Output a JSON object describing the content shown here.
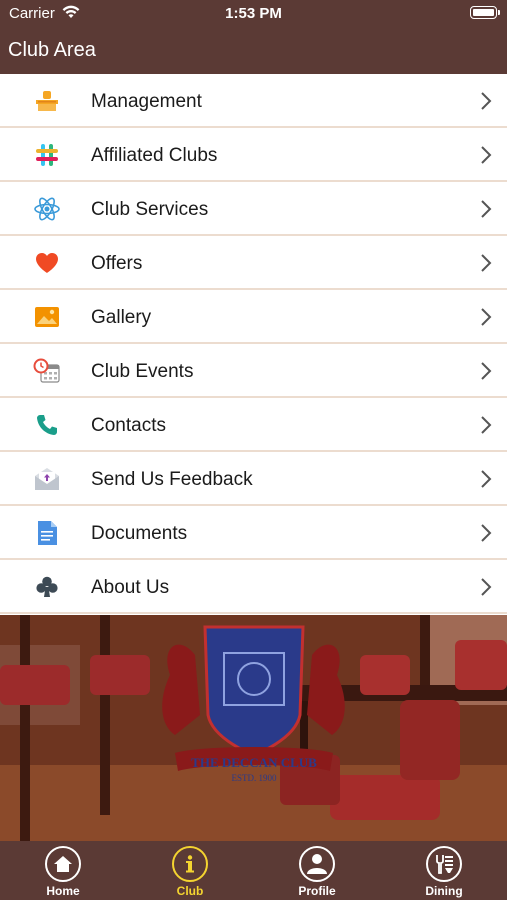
{
  "status_bar": {
    "carrier": "Carrier",
    "time": "1:53 PM"
  },
  "header": {
    "title": "Club Area"
  },
  "menu": {
    "items": [
      {
        "label": "Management",
        "icon": "management-desk-icon"
      },
      {
        "label": "Affiliated Clubs",
        "icon": "slack-hash-icon"
      },
      {
        "label": "Club Services",
        "icon": "atom-icon"
      },
      {
        "label": "Offers",
        "icon": "heart-icon"
      },
      {
        "label": "Gallery",
        "icon": "picture-icon"
      },
      {
        "label": "Club Events",
        "icon": "calendar-clock-icon"
      },
      {
        "label": "Contacts",
        "icon": "phone-icon"
      },
      {
        "label": "Send Us Feedback",
        "icon": "feedback-envelope-icon"
      },
      {
        "label": "Documents",
        "icon": "document-icon"
      },
      {
        "label": "About Us",
        "icon": "club-suit-icon"
      }
    ]
  },
  "banner": {
    "logo_text": "THE DECCAN CLUB",
    "logo_estd": "ESTD. 1900"
  },
  "tab_bar": {
    "tabs": [
      {
        "label": "Home",
        "icon": "home-icon",
        "active": false
      },
      {
        "label": "Club",
        "icon": "info-icon",
        "active": true
      },
      {
        "label": "Profile",
        "icon": "profile-icon",
        "active": false
      },
      {
        "label": "Dining",
        "icon": "dining-icon",
        "active": false
      }
    ]
  },
  "colors": {
    "header_bg": "#5b3a35",
    "active_tab": "#f4d430",
    "divider": "#ecdccf"
  }
}
